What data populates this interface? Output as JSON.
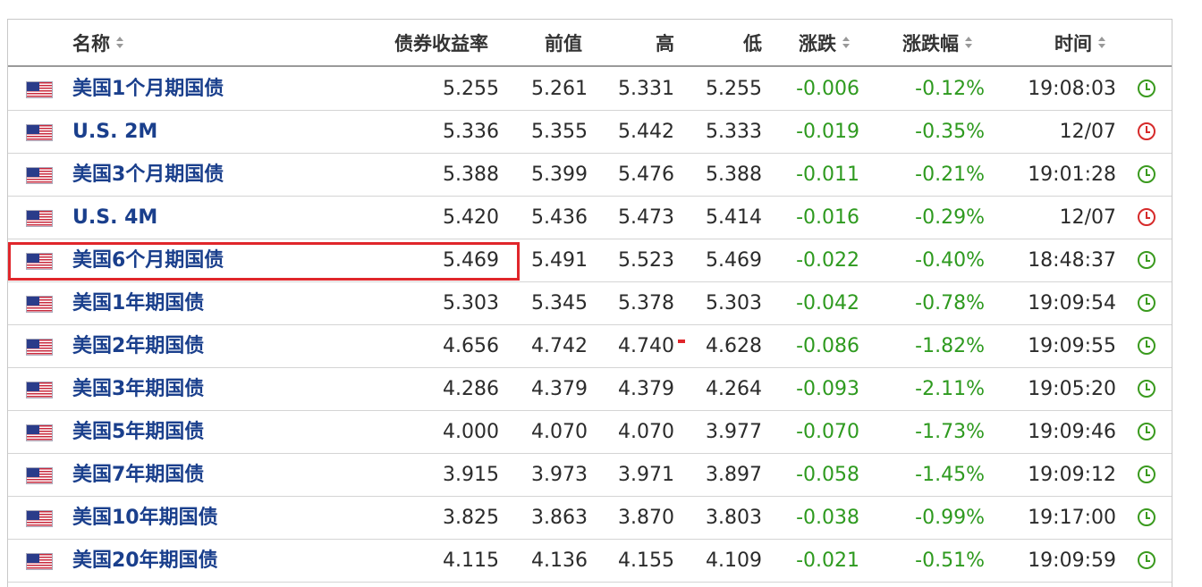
{
  "table": {
    "headers": {
      "name": "名称",
      "yield": "债券收益率",
      "prev": "前值",
      "high": "高",
      "low": "低",
      "change": "涨跌",
      "change_pct": "涨跌幅",
      "time": "时间"
    },
    "rows": [
      {
        "name": "美国1个月期国债",
        "yield": "5.255",
        "prev": "5.261",
        "high": "5.331",
        "low": "5.255",
        "change": "-0.006",
        "change_pct": "-0.12%",
        "time": "19:08:03",
        "status": "open"
      },
      {
        "name": "U.S. 2M",
        "yield": "5.336",
        "prev": "5.355",
        "high": "5.442",
        "low": "5.333",
        "change": "-0.019",
        "change_pct": "-0.35%",
        "time": "12/07",
        "status": "closed"
      },
      {
        "name": "美国3个月期国债",
        "yield": "5.388",
        "prev": "5.399",
        "high": "5.476",
        "low": "5.388",
        "change": "-0.011",
        "change_pct": "-0.21%",
        "time": "19:01:28",
        "status": "open"
      },
      {
        "name": "U.S. 4M",
        "yield": "5.420",
        "prev": "5.436",
        "high": "5.473",
        "low": "5.414",
        "change": "-0.016",
        "change_pct": "-0.29%",
        "time": "12/07",
        "status": "closed"
      },
      {
        "name": "美国6个月期国债",
        "yield": "5.469",
        "prev": "5.491",
        "high": "5.523",
        "low": "5.469",
        "change": "-0.022",
        "change_pct": "-0.40%",
        "time": "18:48:37",
        "status": "open"
      },
      {
        "name": "美国1年期国债",
        "yield": "5.303",
        "prev": "5.345",
        "high": "5.378",
        "low": "5.303",
        "change": "-0.042",
        "change_pct": "-0.78%",
        "time": "19:09:54",
        "status": "open"
      },
      {
        "name": "美国2年期国债",
        "yield": "4.656",
        "prev": "4.742",
        "high": "4.740",
        "low": "4.628",
        "change": "-0.086",
        "change_pct": "-1.82%",
        "time": "19:09:55",
        "status": "open"
      },
      {
        "name": "美国3年期国债",
        "yield": "4.286",
        "prev": "4.379",
        "high": "4.379",
        "low": "4.264",
        "change": "-0.093",
        "change_pct": "-2.11%",
        "time": "19:05:20",
        "status": "open"
      },
      {
        "name": "美国5年期国债",
        "yield": "4.000",
        "prev": "4.070",
        "high": "4.070",
        "low": "3.977",
        "change": "-0.070",
        "change_pct": "-1.73%",
        "time": "19:09:46",
        "status": "open"
      },
      {
        "name": "美国7年期国债",
        "yield": "3.915",
        "prev": "3.973",
        "high": "3.971",
        "low": "3.897",
        "change": "-0.058",
        "change_pct": "-1.45%",
        "time": "19:09:12",
        "status": "open"
      },
      {
        "name": "美国10年期国债",
        "yield": "3.825",
        "prev": "3.863",
        "high": "3.870",
        "low": "3.803",
        "change": "-0.038",
        "change_pct": "-0.99%",
        "time": "19:17:00",
        "status": "open"
      },
      {
        "name": "美国20年期国债",
        "yield": "4.115",
        "prev": "4.136",
        "high": "4.155",
        "low": "4.109",
        "change": "-0.021",
        "change_pct": "-0.51%",
        "time": "19:09:59",
        "status": "open"
      }
    ]
  },
  "icons": {
    "flag": "us-flag-icon",
    "clock_open": "clock-icon",
    "clock_closed": "clock-icon"
  },
  "colors": {
    "name_text": "#1a3f8c",
    "negative": "#2e9a1f",
    "clock_open": "#3a9a1e",
    "clock_closed": "#d62a2a",
    "highlight": "#e0262b"
  }
}
